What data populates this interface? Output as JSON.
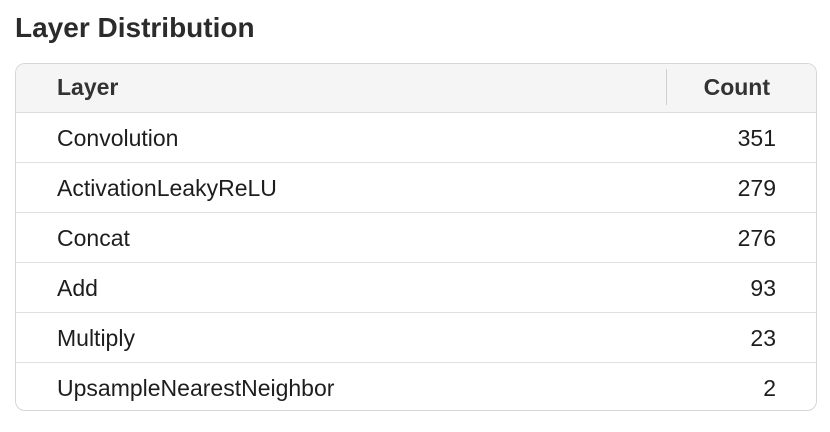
{
  "section": {
    "title": "Layer Distribution"
  },
  "table": {
    "columns": {
      "layer": "Layer",
      "count": "Count"
    },
    "rows": [
      {
        "layer": "Convolution",
        "count": "351"
      },
      {
        "layer": "ActivationLeakyReLU",
        "count": "279"
      },
      {
        "layer": "Concat",
        "count": "276"
      },
      {
        "layer": "Add",
        "count": "93"
      },
      {
        "layer": "Multiply",
        "count": "23"
      },
      {
        "layer": "UpsampleNearestNeighbor",
        "count": "2"
      }
    ]
  }
}
